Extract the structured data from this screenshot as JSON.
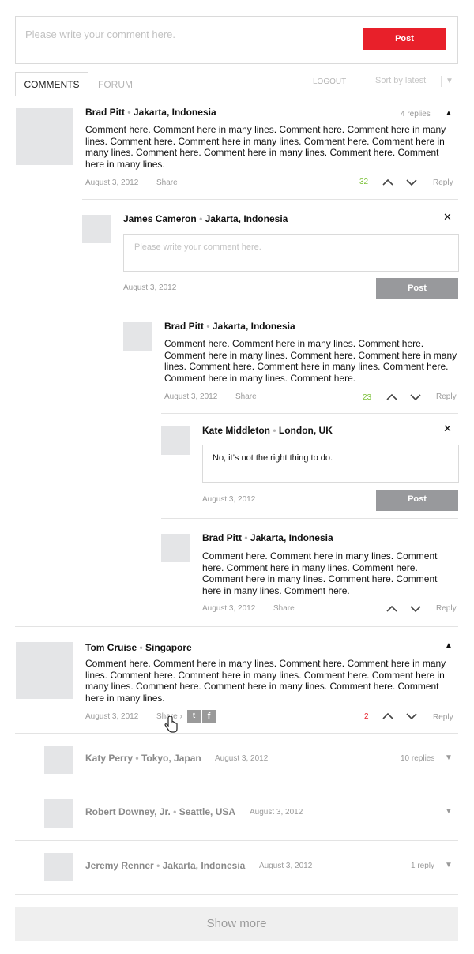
{
  "top_form": {
    "placeholder": "Please write your comment here.",
    "post_label": "Post"
  },
  "tabs": {
    "comments": "COMMENTS",
    "forum": "FORUM",
    "logout": "LOGOUT",
    "sort": "Sort by latest"
  },
  "sep": "•",
  "c1": {
    "name": "Brad Pitt",
    "location": "Jakarta, Indonesia",
    "replies": "4 replies",
    "text": "Comment here. Comment here in many lines. Comment here. Comment here in many lines. Comment here. Comment here in many lines. Comment here. Comment here in many lines. Comment here. Comment here in many lines. Comment here. Comment here in many lines.",
    "date": "August 3, 2012",
    "share": "Share",
    "votes": "32",
    "reply": "Reply"
  },
  "r1": {
    "name": "James Cameron",
    "location": "Jakarta, Indonesia",
    "placeholder": "Please write your comment here.",
    "date": "August 3, 2012",
    "post_label": "Post"
  },
  "r2": {
    "name": "Brad Pitt",
    "location": "Jakarta, Indonesia",
    "text": "Comment here. Comment here in many lines. Comment here. Comment here in many lines. Comment here. Comment here in many lines. Comment here. Comment here in many lines. Comment here. Comment here in many lines. Comment here.",
    "date": "August 3, 2012",
    "share": "Share",
    "votes": "23",
    "reply": "Reply"
  },
  "r3": {
    "name": "Kate Middleton",
    "location": "London, UK",
    "value": "No, it’s not the right thing to do.",
    "date": "August 3, 2012",
    "post_label": "Post"
  },
  "r4": {
    "name": "Brad Pitt",
    "location": "Jakarta, Indonesia",
    "text": "Comment here. Comment here in many lines. Comment here. Comment here in many lines. Comment here. Comment here in many lines. Comment here. Comment here in many lines. Comment here.",
    "date": "August 3, 2012",
    "share": "Share",
    "reply": "Reply"
  },
  "c2": {
    "name": "Tom Cruise",
    "location": "Singapore",
    "text": "Comment here. Comment here in many lines. Comment here. Comment here in many lines. Comment here. Comment here in many lines. Comment here. Comment here in many lines. Comment here. Comment here in many lines. Comment here. Comment here in many lines.",
    "date": "August 3, 2012",
    "share": "Share ›",
    "votes": "2",
    "reply": "Reply"
  },
  "c3": {
    "name": "Katy Perry",
    "location": "Tokyo, Japan",
    "date": "August 3, 2012",
    "replies": "10 replies"
  },
  "c4": {
    "name": "Robert Downey, Jr.",
    "location": "Seattle, USA",
    "date": "August 3, 2012"
  },
  "c5": {
    "name": "Jeremy Renner",
    "location": "Jakarta, Indonesia",
    "date": "August 3, 2012",
    "replies": "1 reply"
  },
  "show_more": "Show more",
  "colors": {
    "accent_red": "#e8202a",
    "vote_positive": "#7dc23a",
    "vote_negative": "#e8202a",
    "button_grey": "#98999c"
  }
}
